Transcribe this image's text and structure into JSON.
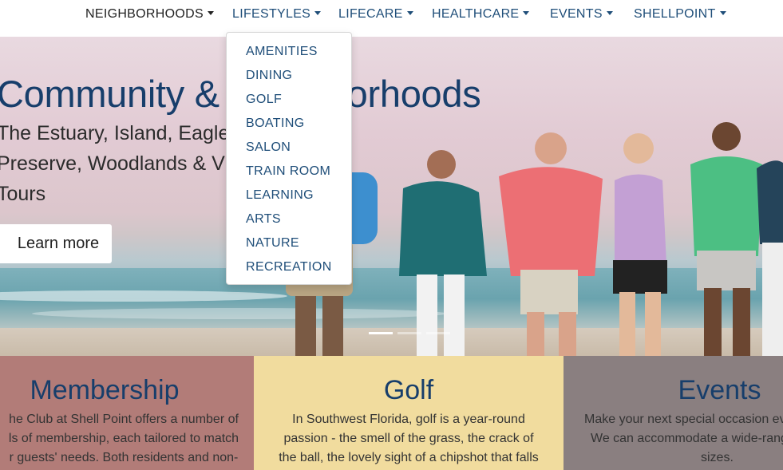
{
  "nav": {
    "items": [
      {
        "label": "NEIGHBORHOODS"
      },
      {
        "label": "LIFESTYLES"
      },
      {
        "label": "LIFECARE"
      },
      {
        "label": "HEALTHCARE"
      },
      {
        "label": "EVENTS"
      },
      {
        "label": "SHELLPOINT"
      }
    ]
  },
  "dropdown": {
    "items": [
      "AMENITIES",
      "DINING",
      "GOLF",
      "BOATING",
      "SALON",
      "TRAIN ROOM",
      "LEARNING",
      "ARTS",
      "NATURE",
      "RECREATION"
    ]
  },
  "hero": {
    "title": "Community & Neighborhoods",
    "subtitle_lines": [
      "The Estuary, Island, Eagles",
      "Preserve, Woodlands & Vi",
      "Tours"
    ],
    "button_label": "Learn more",
    "slides_total": 3,
    "active_slide": 1
  },
  "cards": [
    {
      "title": "Membership",
      "lines": [
        "he Club at Shell Point offers a number of",
        "ls of membership, each tailored to match",
        "r guests' needs. Both residents and non-"
      ],
      "color": "#b27c78"
    },
    {
      "title": "Golf",
      "lines": [
        "In Southwest Florida, golf is a year-round",
        "passion - the smell of the grass, the crack of",
        "the ball, the lovely sight of a chipshot that falls"
      ],
      "color": "#f1dc9e"
    },
    {
      "title": "Events",
      "lines": [
        "Make your next special occasion ev",
        "We can accommodate a wide-rang",
        "sizes."
      ],
      "color": "#8a7f80"
    }
  ],
  "colors": {
    "brand_navy": "#173e6b",
    "nav_link": "#1f4e79"
  }
}
